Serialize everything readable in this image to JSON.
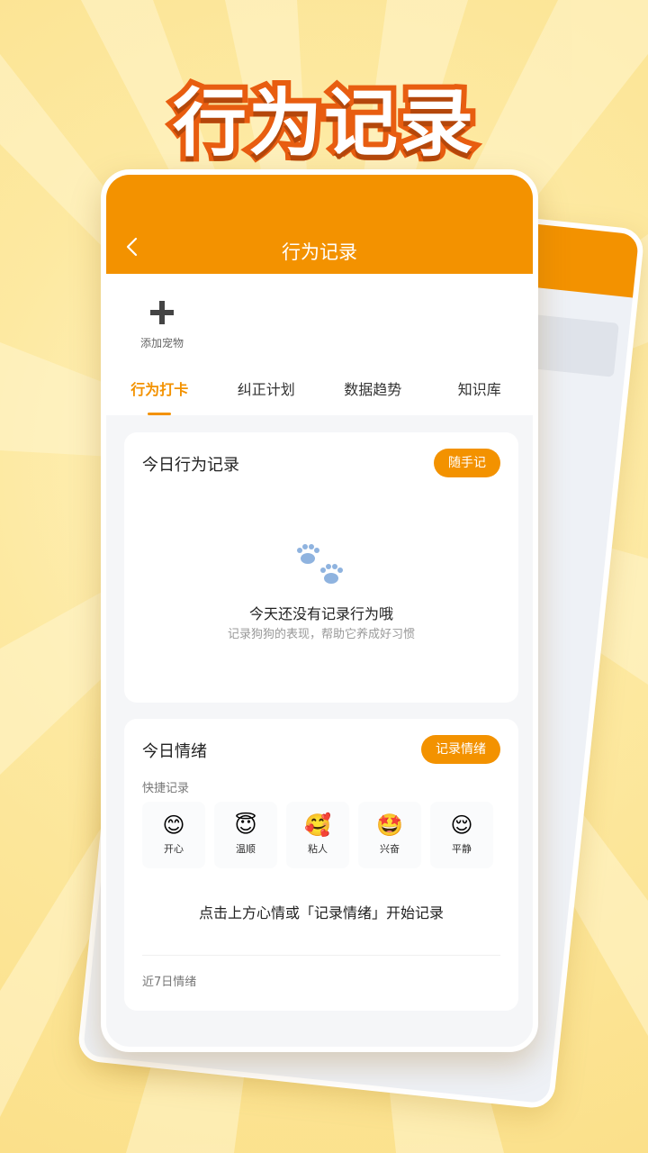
{
  "banner": {
    "title": "行为记录"
  },
  "navbar": {
    "title": "行为记录",
    "back_icon": "chevron-left-icon"
  },
  "pets": {
    "add_label": "添加宠物",
    "add_icon": "plus-icon"
  },
  "tabs": [
    {
      "label": "行为打卡",
      "active": true
    },
    {
      "label": "纠正计划",
      "active": false
    },
    {
      "label": "数据趋势",
      "active": false
    },
    {
      "label": "知识库",
      "active": false
    }
  ],
  "behavior_card": {
    "title": "今日行为记录",
    "button": "随手记",
    "empty_icon": "paw-icon",
    "empty_title": "今天还没有记录行为哦",
    "empty_subtitle": "记录狗狗的表现，帮助它养成好习惯"
  },
  "mood_card": {
    "title": "今日情绪",
    "button": "记录情绪",
    "quick_label": "快捷记录",
    "moods": [
      {
        "emoji": "😊",
        "label": "开心"
      },
      {
        "emoji": "😇",
        "label": "温顺"
      },
      {
        "emoji": "🥰",
        "label": "粘人"
      },
      {
        "emoji": "🤩",
        "label": "兴奋"
      },
      {
        "emoji": "😌",
        "label": "平静"
      }
    ],
    "hint": "点击上方心情或「记录情绪」开始记录",
    "recent_label": "近7日情绪"
  },
  "colors": {
    "accent": "#f39200",
    "banner_stroke": "#e85d10",
    "background": "#fdeaa3"
  }
}
